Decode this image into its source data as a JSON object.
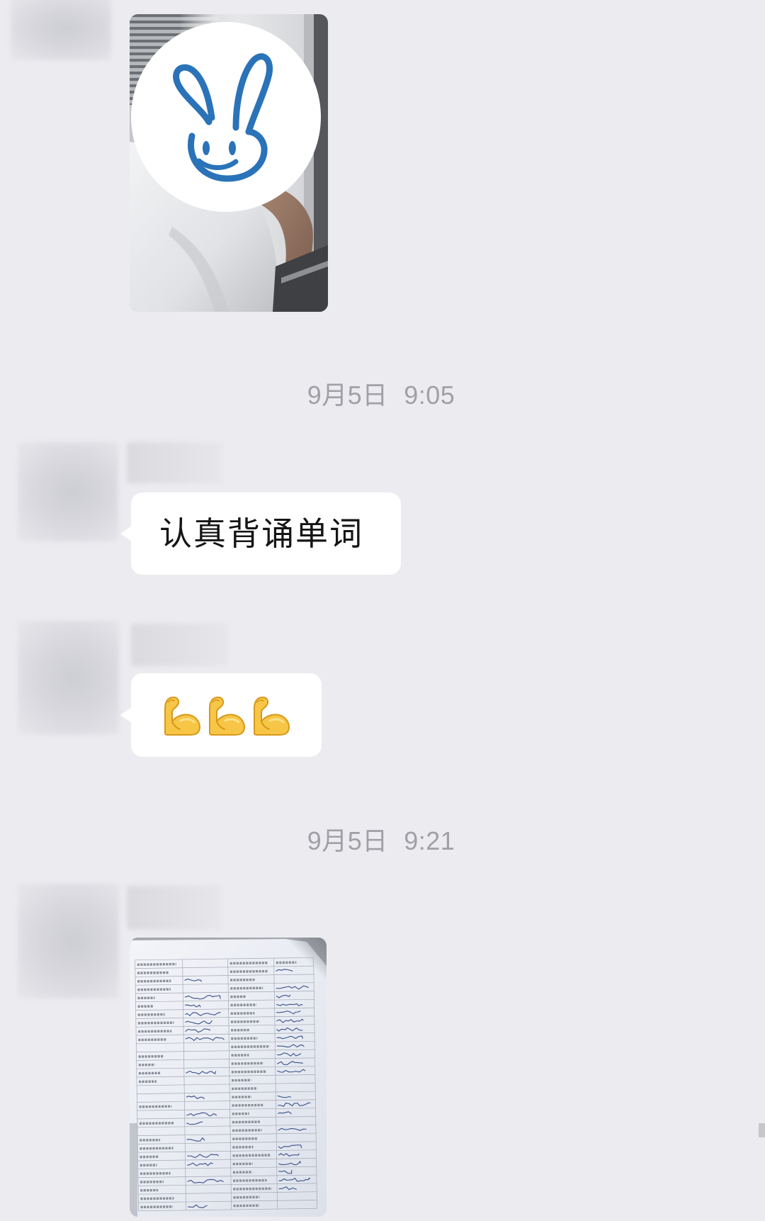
{
  "colors": {
    "background": "#ececf0",
    "bubble": "#ffffff",
    "message_text": "#151515",
    "timestamp_text": "#a0a0a6",
    "blur_placeholder": "#d6d6dc",
    "rabbit_blue": "#2b73b8",
    "ink_blue": "#3b4f8a"
  },
  "chat": {
    "photo_message": {
      "sticker_icon": "rabbit-icon"
    },
    "timestamp_1": "9月5日 9:05",
    "text_message": {
      "text": "认真背诵单词"
    },
    "emoji_message": {
      "emojis": [
        "flexed-biceps-icon",
        "flexed-biceps-icon",
        "flexed-biceps-icon"
      ]
    },
    "timestamp_2": "9月5日 9:21"
  }
}
